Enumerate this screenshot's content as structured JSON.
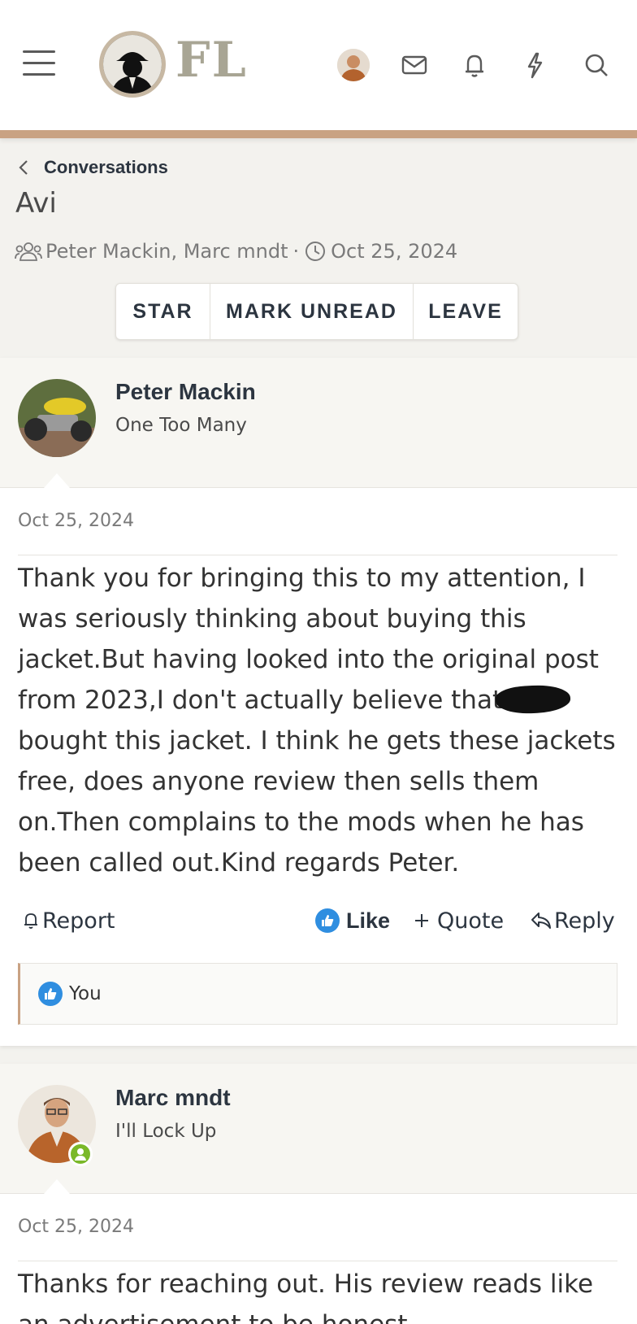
{
  "header": {
    "logo_text": "FL",
    "icons": [
      "menu-icon",
      "user-avatar",
      "envelope-icon",
      "bell-icon",
      "bolt-icon",
      "search-icon"
    ]
  },
  "breadcrumb": {
    "label": "Conversations"
  },
  "conversation": {
    "title": "Avi",
    "participants": "Peter Mackin, Marc mndt",
    "separator": "·",
    "date": "Oct 25, 2024"
  },
  "buttons": {
    "star": "STAR",
    "mark_unread": "MARK UNREAD",
    "leave": "LEAVE"
  },
  "messages": [
    {
      "author": "Peter Mackin",
      "user_title": "One Too Many",
      "date": "Oct 25, 2024",
      "body_line1": "Thank you for bringing this to my attention, I was seriously thinking about buying this jacket.But having looked into the original post from 2023,I don't actually believe that",
      "body_line2": "bought this jacket. I think he gets these jackets free, does anyone review then sells them on.Then complains to the mods when he has been called out.Kind regards Peter.",
      "actions": {
        "report": "Report",
        "like": "Like",
        "quote": "Quote",
        "reply": "Reply"
      },
      "likes": "You"
    },
    {
      "author": "Marc mndt",
      "user_title": "I'll Lock Up",
      "date": "Oct 25, 2024",
      "body": "Thanks for reaching out. His review reads like an advertisement to be honest."
    }
  ],
  "colors": {
    "accent": "#c9a283",
    "like_blue": "#2f8ee0",
    "online_green": "#7ab828"
  }
}
